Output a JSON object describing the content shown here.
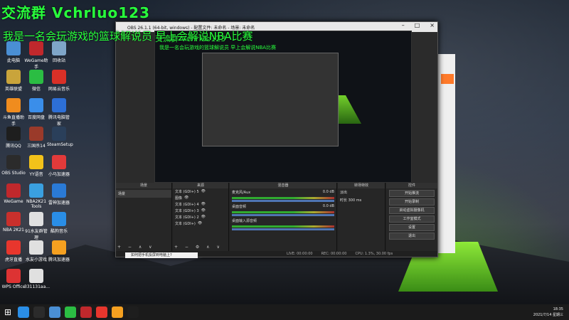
{
  "overlay": {
    "title": "交流群 Vchrluo123",
    "subtitle": "我是一名会玩游戏的篮球解说员 早上会解说NBA比赛"
  },
  "desktop_icons": [
    {
      "label": "此电脑",
      "icon": "computer-icon",
      "color": "#4a8fd4"
    },
    {
      "label": "WeGame助手",
      "icon": "wegame-icon",
      "color": "#c0282c"
    },
    {
      "label": "回收站",
      "icon": "recycle-bin-icon",
      "color": "#7fa6c9"
    },
    {
      "label": "英雄联盟",
      "icon": "lol-icon",
      "color": "#c9a43b"
    },
    {
      "label": "微信",
      "icon": "wechat-icon",
      "color": "#2bbd43"
    },
    {
      "label": "网易云音乐",
      "icon": "netease-music-icon",
      "color": "#d93027"
    },
    {
      "label": "斗鱼直播助手",
      "icon": "douyu-icon",
      "color": "#f08c1e"
    },
    {
      "label": "百度网盘",
      "icon": "baidu-netdisk-icon",
      "color": "#3a8eea"
    },
    {
      "label": "腾讯电脑管家",
      "icon": "pc-manager-icon",
      "color": "#2d6fd6"
    },
    {
      "label": "腾讯QQ",
      "icon": "qq-icon",
      "color": "#1e1e1e"
    },
    {
      "label": "三国杀14",
      "icon": "sanguosha-icon",
      "color": "#9a3a2a"
    },
    {
      "label": "SteamSetup",
      "icon": "steam-icon",
      "color": "#2a3f5a"
    },
    {
      "label": "OBS Studio",
      "icon": "obs-icon",
      "color": "#2b2b2b"
    },
    {
      "label": "YY语音",
      "icon": "yy-icon",
      "color": "#f2c21a"
    },
    {
      "label": "小马加速器",
      "icon": "accelerator-icon",
      "color": "#e23a3a"
    },
    {
      "label": "WeGame",
      "icon": "wegame-icon",
      "color": "#c0282c"
    },
    {
      "label": "NBA2K21 Tools",
      "icon": "tools-icon",
      "color": "#3aa0e0"
    },
    {
      "label": "雷神加速器",
      "icon": "leishen-icon",
      "color": "#2a7ad6"
    },
    {
      "label": "NBA 2K21",
      "icon": "nba2k-icon",
      "color": "#c9302c"
    },
    {
      "label": "91水友群管理",
      "icon": "document-icon",
      "color": "#e0e0e0"
    },
    {
      "label": "酷狗音乐",
      "icon": "kugou-icon",
      "color": "#2a8ee6"
    },
    {
      "label": "虎牙直播",
      "icon": "huya-icon",
      "color": "#e8362d"
    },
    {
      "label": "水友小游戏",
      "icon": "document-icon",
      "color": "#e0e0e0"
    },
    {
      "label": "腾讯加速器",
      "icon": "tencent-accel-icon",
      "color": "#f5a020"
    },
    {
      "label": "WPS Office",
      "icon": "wps-icon",
      "color": "#d33"
    },
    {
      "label": "331131aa...",
      "icon": "document-icon",
      "color": "#e0e0e0"
    }
  ],
  "obs": {
    "title": "OBS 26.1.1 (64-bit, windows) - 配置文件: 未命名 - 场景: 未命名",
    "menu": [
      "文件(F)",
      "编辑(E)",
      "视图(V)",
      "停靠部件(D)",
      "配置文件(P)",
      "场景集合(S)",
      "工具(T)",
      "帮助(H)"
    ],
    "panels": {
      "scenes_header": "场景",
      "scene_item": "场景",
      "sources_header": "来源",
      "sources": [
        "文本 (GDI+) 5",
        "图像",
        "文本 (GDI+) 4",
        "文本 (GDI+) 3",
        "文本 (GDI+) 2",
        "文本 (GDI+)"
      ],
      "mixer_header": "混音器",
      "mixer": [
        {
          "name": "麦克风/Aux",
          "db": "0.0 dB"
        },
        {
          "name": "桌面音频",
          "db": "0.0 dB"
        },
        {
          "name": "桌面输入源音频",
          "db": ""
        }
      ],
      "transition_header": "转场特效",
      "transition_value": "淡出",
      "duration_label": "时长",
      "duration_value": "300 ms",
      "controls_header": "控件",
      "controls": [
        "开始推流",
        "开始录制",
        "启动虚拟摄像机",
        "工作室模式",
        "设置",
        "退出"
      ]
    },
    "status": {
      "live": "LIVE: 00:00:00",
      "rec": "REC: 00:00:00",
      "cpu": "CPU: 1.3%, 30.00 fps"
    },
    "preview_sub": "配置文件 未命名 - 场景 未命名"
  },
  "notification": "如何把手机投屏到电脑上?",
  "taskbar": {
    "apps": [
      "#2a8ee6",
      "#2b2b2b",
      "#4a8fd4",
      "#2bbd43",
      "#c0282c",
      "#e8362d",
      "#f5a020",
      "#1e1e1e"
    ],
    "time": "18:35",
    "date": "2021/7/14 星期三"
  }
}
